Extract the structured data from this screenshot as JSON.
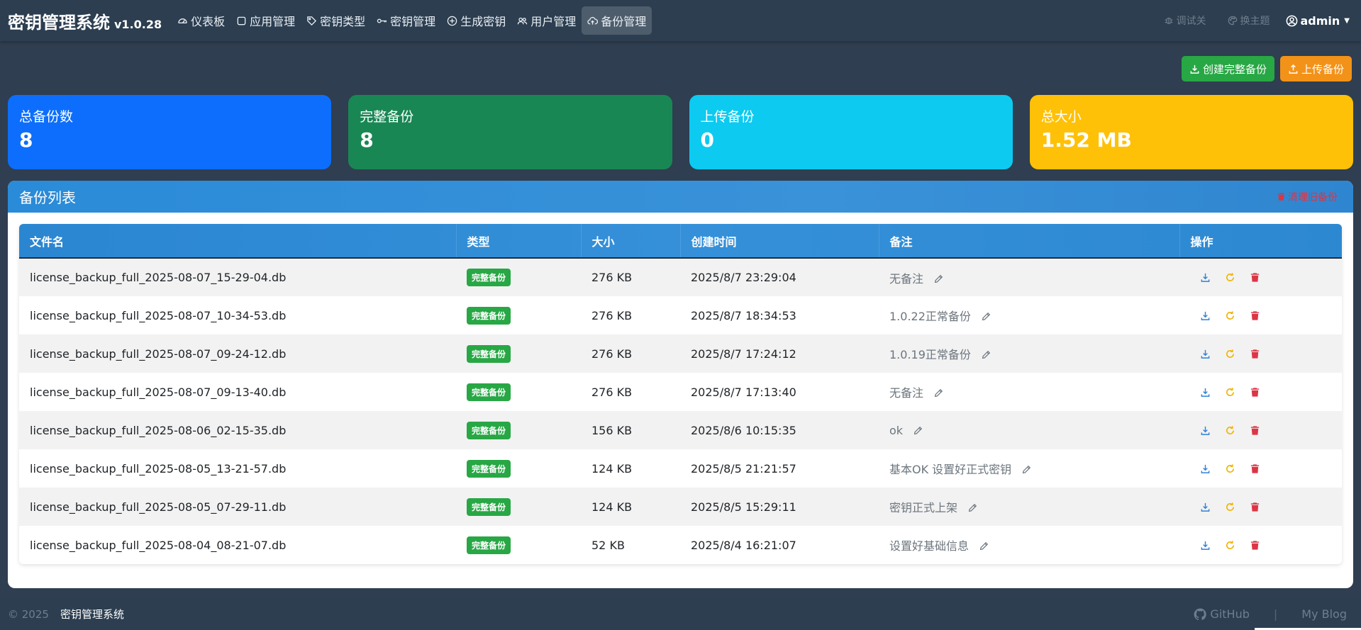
{
  "brand": {
    "title": "密钥管理系统",
    "version": "v1.0.28"
  },
  "nav": [
    {
      "label": "仪表板",
      "icon": "dashboard-icon"
    },
    {
      "label": "应用管理",
      "icon": "square-icon"
    },
    {
      "label": "密钥类型",
      "icon": "tag-icon"
    },
    {
      "label": "密钥管理",
      "icon": "key-icon"
    },
    {
      "label": "生成密钥",
      "icon": "plus-circle-icon"
    },
    {
      "label": "用户管理",
      "icon": "users-icon"
    },
    {
      "label": "备份管理",
      "icon": "cloud-upload-icon",
      "active": true
    }
  ],
  "nav_right": {
    "debug": "调试关",
    "theme": "换主题",
    "user": "admin"
  },
  "actions": {
    "create_full": "创建完整备份",
    "upload": "上传备份"
  },
  "stats": [
    {
      "label": "总备份数",
      "value": "8"
    },
    {
      "label": "完整备份",
      "value": "8"
    },
    {
      "label": "上传备份",
      "value": "0"
    },
    {
      "label": "总大小",
      "value": "1.52 MB"
    }
  ],
  "card": {
    "title": "备份列表",
    "clear_label": "清理旧备份"
  },
  "table": {
    "headers": [
      "文件名",
      "类型",
      "大小",
      "创建时间",
      "备注",
      "操作"
    ],
    "rows": [
      {
        "file": "license_backup_full_2025-08-07_15-29-04.db",
        "type": "完整备份",
        "size": "276 KB",
        "time": "2025/8/7 23:29:04",
        "note": "无备注"
      },
      {
        "file": "license_backup_full_2025-08-07_10-34-53.db",
        "type": "完整备份",
        "size": "276 KB",
        "time": "2025/8/7 18:34:53",
        "note": "1.0.22正常备份"
      },
      {
        "file": "license_backup_full_2025-08-07_09-24-12.db",
        "type": "完整备份",
        "size": "276 KB",
        "time": "2025/8/7 17:24:12",
        "note": "1.0.19正常备份"
      },
      {
        "file": "license_backup_full_2025-08-07_09-13-40.db",
        "type": "完整备份",
        "size": "276 KB",
        "time": "2025/8/7 17:13:40",
        "note": "无备注"
      },
      {
        "file": "license_backup_full_2025-08-06_02-15-35.db",
        "type": "完整备份",
        "size": "156 KB",
        "time": "2025/8/6 10:15:35",
        "note": "ok"
      },
      {
        "file": "license_backup_full_2025-08-05_13-21-57.db",
        "type": "完整备份",
        "size": "124 KB",
        "time": "2025/8/5 21:21:57",
        "note": "基本OK 设置好正式密钥"
      },
      {
        "file": "license_backup_full_2025-08-05_07-29-11.db",
        "type": "完整备份",
        "size": "124 KB",
        "time": "2025/8/5 15:29:11",
        "note": "密钥正式上架"
      },
      {
        "file": "license_backup_full_2025-08-04_08-21-07.db",
        "type": "完整备份",
        "size": "52 KB",
        "time": "2025/8/4 16:21:07",
        "note": "设置好基础信息"
      }
    ]
  },
  "footer": {
    "copyright": "© 2025",
    "brand": "密钥管理系统",
    "github": "GitHub",
    "blog": "My Blog"
  },
  "colors": {
    "navbar": "#2c3e50",
    "primary": "#0d6efd",
    "success": "#198754",
    "info": "#0dcaf0",
    "warning": "#ffc107",
    "danger": "#dc3545"
  }
}
